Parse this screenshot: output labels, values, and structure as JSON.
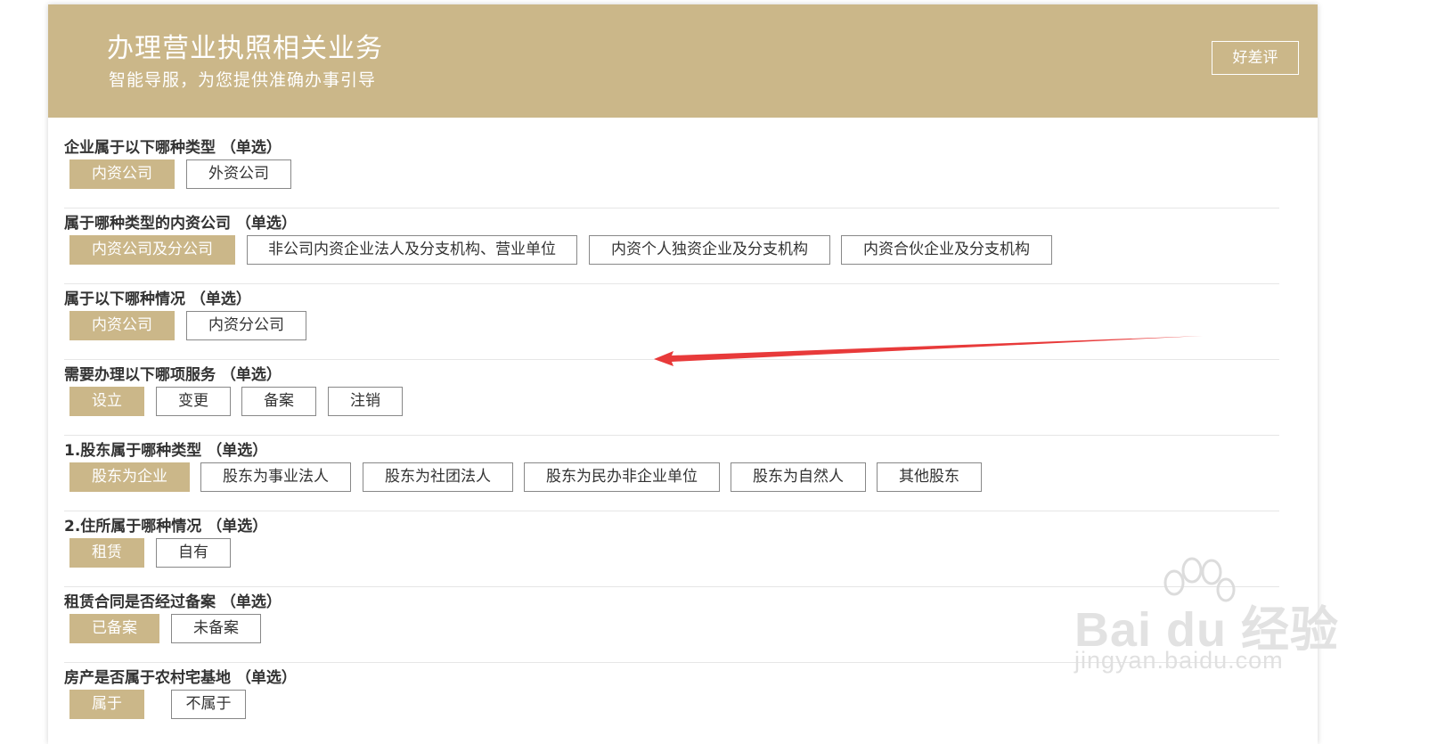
{
  "header": {
    "title": "办理营业执照相关业务",
    "subtitle": "智能导服，为您提供准确办事引导",
    "rate_button": "好差评"
  },
  "sections": [
    {
      "title": "企业属于以下哪种类型 （单选）",
      "options": [
        "内资公司",
        "外资公司"
      ],
      "selected": 0
    },
    {
      "title": "属于哪种类型的内资公司 （单选）",
      "options": [
        "内资公司及分公司",
        "非公司内资企业法人及分支机构、营业单位",
        "内资个人独资企业及分支机构",
        "内资合伙企业及分支机构"
      ],
      "selected": 0
    },
    {
      "title": "属于以下哪种情况 （单选）",
      "options": [
        "内资公司",
        "内资分公司"
      ],
      "selected": 0
    },
    {
      "title": "需要办理以下哪项服务 （单选）",
      "options": [
        "设立",
        "变更",
        "备案",
        "注销"
      ],
      "selected": 0
    },
    {
      "title": "1.股东属于哪种类型 （单选）",
      "options": [
        "股东为企业",
        "股东为事业法人",
        "股东为社团法人",
        "股东为民办非企业单位",
        "股东为自然人",
        "其他股东"
      ],
      "selected": 0
    },
    {
      "title": "2.住所属于哪种情况 （单选）",
      "options": [
        "租赁",
        "自有"
      ],
      "selected": 0
    },
    {
      "title": "租赁合同是否经过备案 （单选）",
      "options": [
        "已备案",
        "未备案"
      ],
      "selected": 0
    },
    {
      "title": "房产是否属于农村宅基地 （单选）",
      "options": [
        "属于",
        "不属于"
      ],
      "selected": 0
    }
  ],
  "watermark": {
    "logo_text": "Bai du 经验",
    "url": "jingyan.baidu.com"
  },
  "colors": {
    "accent": "#cbb789",
    "annotation_arrow": "#e83a3a"
  }
}
